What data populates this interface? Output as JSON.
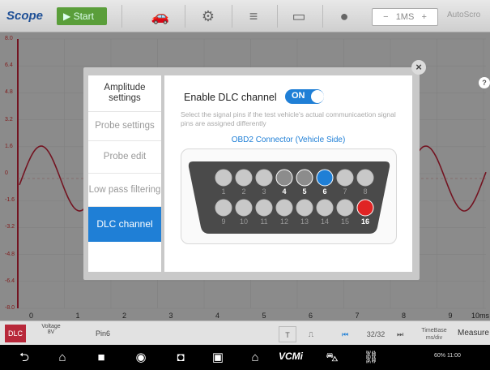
{
  "app": {
    "logo": "Scope",
    "start_label": "Start"
  },
  "toolbar": {
    "timebase": "1MS",
    "timebase_minus": "−",
    "timebase_plus": "+",
    "autoscroll": "AutoScro"
  },
  "scope": {
    "y_labels": [
      "8.0",
      "6.4",
      "4.8",
      "3.2",
      "1.6",
      "0",
      "-1.6",
      "-3.2",
      "-4.8",
      "-6.4",
      "-8.0"
    ],
    "x_ticks": [
      "0",
      "1",
      "2",
      "3",
      "4",
      "5",
      "6",
      "7",
      "8",
      "9",
      "10ms"
    ]
  },
  "control_bar": {
    "channel_tag": "DLC",
    "voltage_title": "Voltage",
    "voltage_value": "8V",
    "pin": "Pin6",
    "trigger_t": "T",
    "page": "32/32",
    "timebase_title": "TimeBase",
    "timebase_value": "ms/div",
    "measure": "Measure"
  },
  "dialog": {
    "menu": [
      "Amplitude settings",
      "Probe settings",
      "Probe edit",
      "Low pass filtering",
      "DLC channel"
    ],
    "active_index": 4,
    "enable_label": "Enable DLC channel",
    "toggle_state": "ON",
    "hint": "Select the signal pins if the test vehicle's actual communicaetion signal pins are assigned differently",
    "connector_title": "OBD2 Connector (Vehicle Side)",
    "pins_top": [
      "1",
      "2",
      "3",
      "4",
      "5",
      "6",
      "7",
      "8"
    ],
    "pins_bottom": [
      "9",
      "10",
      "11",
      "12",
      "13",
      "14",
      "15",
      "16"
    ],
    "pin_states": {
      "4": "grey",
      "5": "grey",
      "6": "selected",
      "16": "power"
    },
    "colors": {
      "selected": "#1f7fd6",
      "power": "#e02424",
      "grey": "#8c8c8c",
      "idle": "#c8c8c8"
    }
  },
  "navbar": {
    "vcm_label": "VCMi",
    "status_text": "60%  11:00"
  }
}
